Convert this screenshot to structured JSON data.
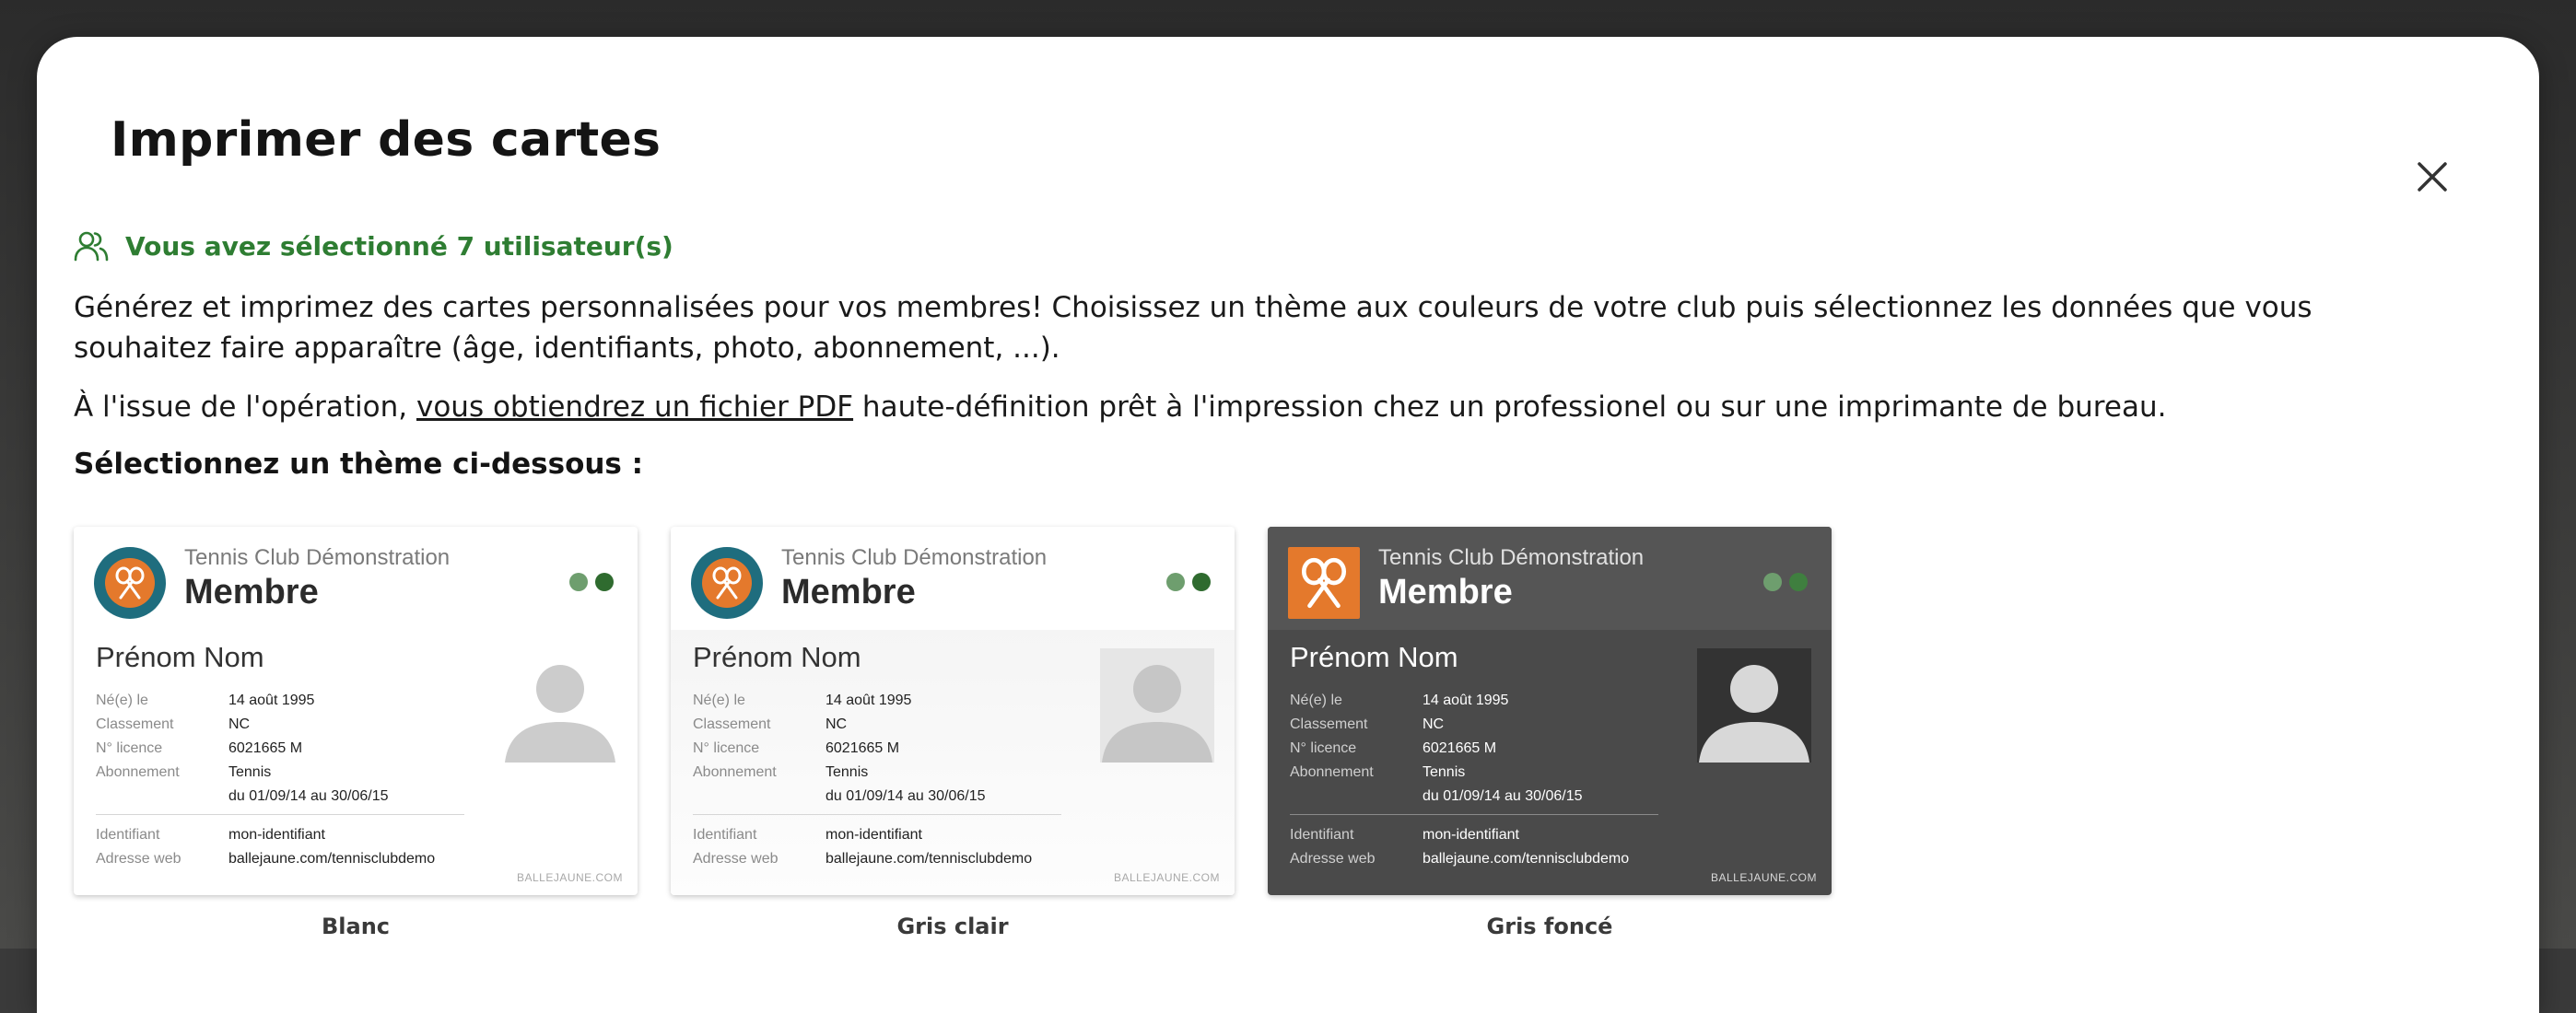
{
  "modal": {
    "title": "Imprimer des cartes",
    "selection": "Vous avez sélectionné 7 utilisateur(s)",
    "intro": "Générez et imprimez des cartes personnalisées pour vos membres! Choisissez un thème aux couleurs de votre club puis sélectionnez les données que vous souhaitez faire apparaître (âge, identifiants, photo, abonnement, ...).",
    "result_prefix": "À l'issue de l'opération, ",
    "result_link": "vous obtiendrez un fichier PDF",
    "result_suffix": " haute-définition prêt à l'impression chez un professionel ou sur une imprimante de bureau.",
    "section_label": "Sélectionnez un thème ci-dessous :"
  },
  "card_sample": {
    "club": "Tennis Club Démonstration",
    "role": "Membre",
    "holder": "Prénom Nom",
    "born_label": "Né(e) le",
    "born_value": "14 août 1995",
    "rank_label": "Classement",
    "rank_value": "NC",
    "licence_label": "N° licence",
    "licence_value": "6021665 M",
    "sub_label": "Abonnement",
    "sub_value_1": "Tennis",
    "sub_value_2": "du 01/09/14 au 30/06/15",
    "id_label": "Identifiant",
    "id_value": "mon-identifiant",
    "web_label": "Adresse web",
    "web_value": "ballejaune.com/tennisclubdemo",
    "brand": "BALLEJAUNE.COM"
  },
  "themes": [
    {
      "name": "Blanc"
    },
    {
      "name": "Gris clair"
    },
    {
      "name": "Gris foncé"
    }
  ],
  "colors": {
    "accent_green": "#2e7d32",
    "logo_orange": "#e4792c",
    "logo_teal": "#1f6d7e"
  }
}
